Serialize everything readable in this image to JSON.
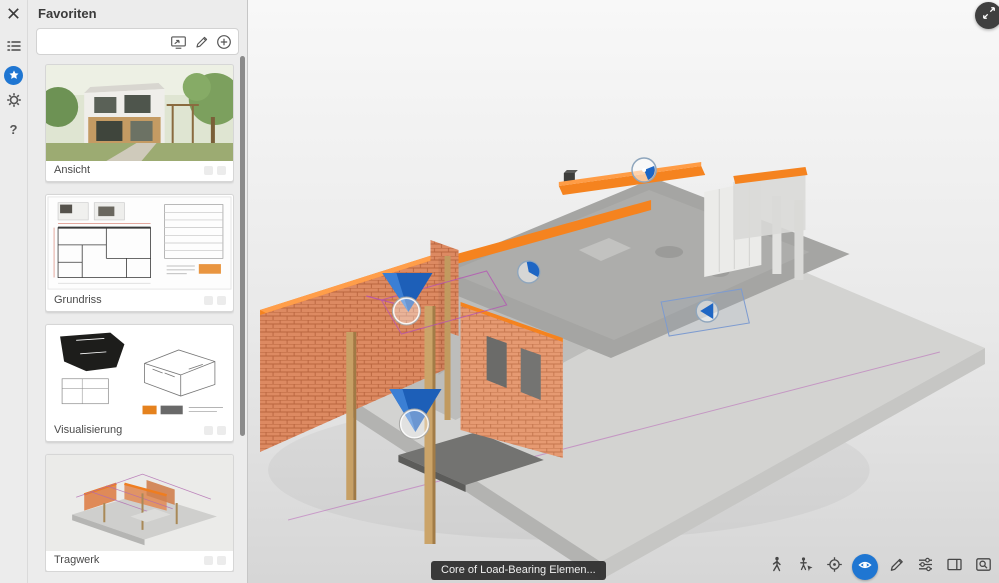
{
  "panel": {
    "title": "Favoriten",
    "search": {
      "value": "",
      "placeholder": ""
    },
    "items": [
      {
        "label": "Ansicht"
      },
      {
        "label": "Grundriss"
      },
      {
        "label": "Visualisierung"
      },
      {
        "label": "Tragwerk"
      }
    ]
  },
  "rail": {
    "items": [
      "close",
      "list",
      "favorites",
      "settings",
      "help"
    ],
    "active": "favorites",
    "help_glyph": "?"
  },
  "viewport": {
    "tooltip": "Core of Load-Bearing Elemen...",
    "toolbar": [
      "walk",
      "person-select",
      "center-view",
      "view-mode",
      "measure",
      "filter",
      "layout",
      "search-model"
    ]
  },
  "colors": {
    "accent": "#1f76d2",
    "highlight_orange": "#f5831f",
    "marker_blue": "#1d5fb8",
    "tooltip_bg": "#2d2d2d"
  }
}
